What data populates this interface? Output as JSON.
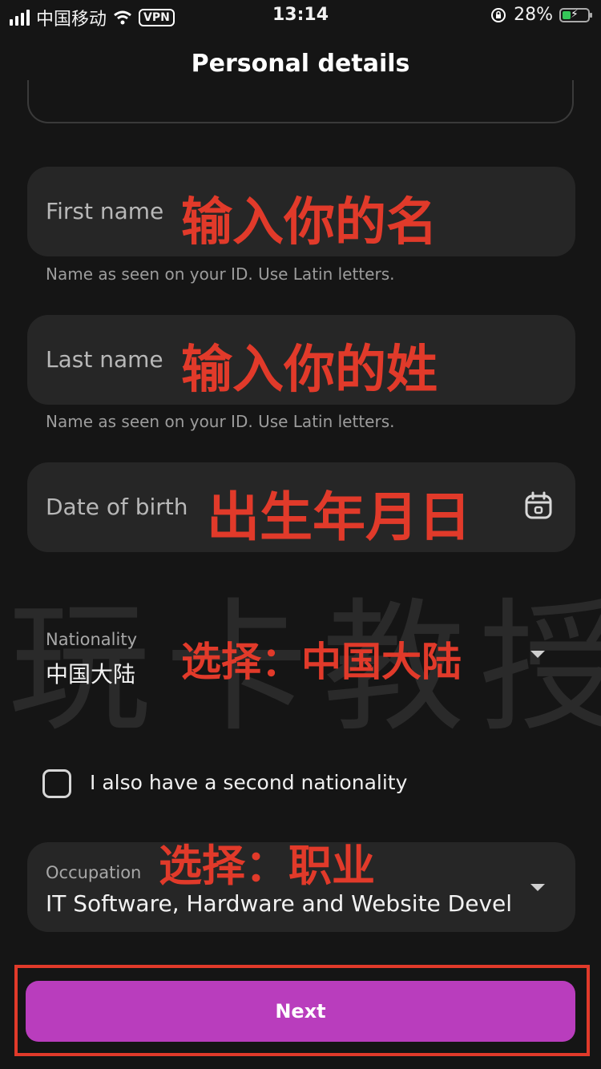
{
  "status_bar": {
    "carrier": "中国移动",
    "vpn": "VPN",
    "time": "13:14",
    "battery": "28%"
  },
  "header": {
    "title": "Personal details"
  },
  "form": {
    "first_name": {
      "placeholder": "First name",
      "helper": "Name as seen on your ID. Use Latin letters."
    },
    "last_name": {
      "placeholder": "Last name",
      "helper": "Name as seen on your ID. Use Latin letters."
    },
    "dob": {
      "placeholder": "Date of birth"
    },
    "nationality": {
      "label": "Nationality",
      "value": "中国大陆"
    },
    "second_nationality": {
      "label": "I also have a second nationality",
      "checked": false
    },
    "occupation": {
      "label": "Occupation",
      "value": "IT Software, Hardware and Website Devel"
    },
    "next_label": "Next"
  },
  "annotations": {
    "first_name": "输入你的名",
    "last_name": "输入你的姓",
    "dob": "出生年月日",
    "nationality": "选择：中国大陆",
    "occupation": "选择：职业"
  },
  "watermark": "玩卡教授",
  "colors": {
    "background": "#151515",
    "field": "#262626",
    "accent": "#b93dbd",
    "annotation": "#e13a2a"
  },
  "icons": [
    "signal-icon",
    "wifi-icon",
    "rotation-lock-icon",
    "battery-icon",
    "calendar-icon",
    "chevron-down-icon"
  ]
}
